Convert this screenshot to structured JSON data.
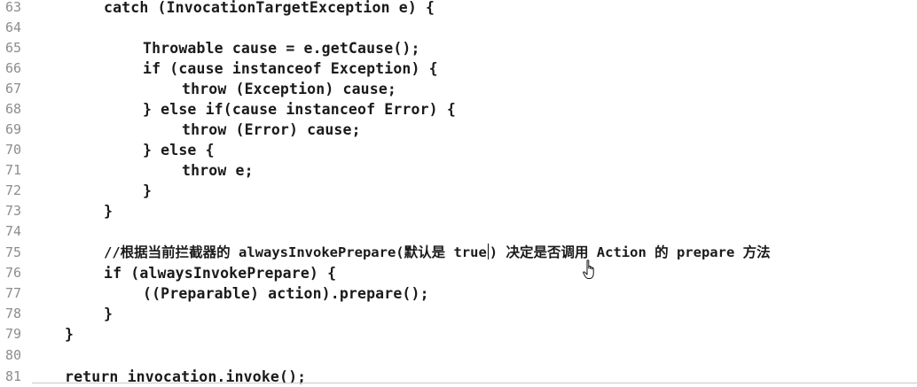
{
  "lines": [
    {
      "num": "63",
      "code": "catch (InvocationTargetException e) {"
    },
    {
      "num": "64",
      "code": ""
    },
    {
      "num": "65",
      "code": "Throwable cause = e.getCause();"
    },
    {
      "num": "66",
      "code": "if (cause instanceof Exception) {"
    },
    {
      "num": "67",
      "code": "throw (Exception) cause;"
    },
    {
      "num": "68",
      "code": "} else if(cause instanceof Error) {"
    },
    {
      "num": "69",
      "code": "throw (Error) cause;"
    },
    {
      "num": "70",
      "code": "} else {"
    },
    {
      "num": "71",
      "code": "throw e;"
    },
    {
      "num": "72",
      "code": "}"
    },
    {
      "num": "73",
      "code": "}"
    },
    {
      "num": "74",
      "code": ""
    },
    {
      "num": "75",
      "code_before_caret": "//根据当前拦截器的 alwaysInvokePrepare(默认是 true",
      "code_after_caret": ") 决定是否调用 Action 的 prepare 方法"
    },
    {
      "num": "76",
      "code": "if (alwaysInvokePrepare) {"
    },
    {
      "num": "77",
      "code": "((Preparable) action).prepare();"
    },
    {
      "num": "78",
      "code": "}"
    },
    {
      "num": "79",
      "code": "}"
    },
    {
      "num": "80",
      "code": ""
    },
    {
      "num": "81",
      "code": "return invocation.invoke();"
    }
  ],
  "icons": {
    "mouse_cursor": "hand-pointer-icon"
  }
}
